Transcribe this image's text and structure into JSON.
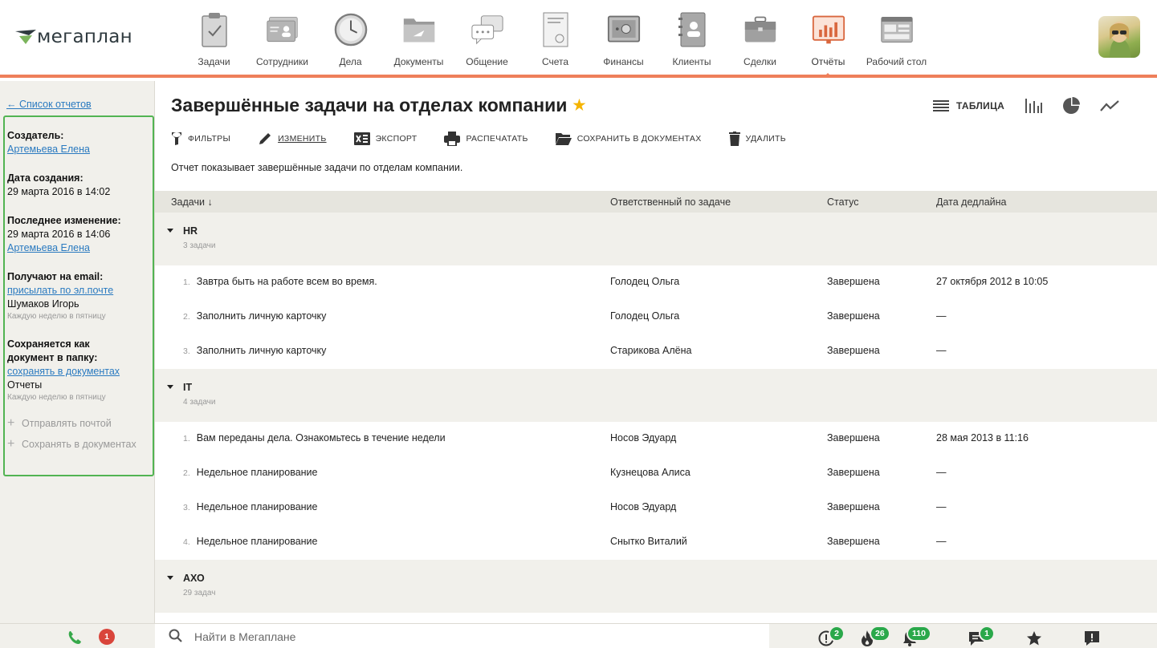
{
  "brand": {
    "name": "мегаплан"
  },
  "nav": [
    {
      "label": "Задачи",
      "icon": "clipboard-check-icon"
    },
    {
      "label": "Сотрудники",
      "icon": "id-card-icon"
    },
    {
      "label": "Дела",
      "icon": "clock-icon"
    },
    {
      "label": "Документы",
      "icon": "folder-icon"
    },
    {
      "label": "Общение",
      "icon": "chat-bubbles-icon"
    },
    {
      "label": "Счета",
      "icon": "invoice-icon"
    },
    {
      "label": "Финансы",
      "icon": "safe-icon"
    },
    {
      "label": "Клиенты",
      "icon": "contacts-book-icon"
    },
    {
      "label": "Сделки",
      "icon": "briefcase-icon"
    },
    {
      "label": "Отчёты",
      "icon": "report-board-icon",
      "active": true
    },
    {
      "label": "Рабочий стол",
      "icon": "dashboard-icon"
    }
  ],
  "sidebar": {
    "back_link": "← Список отчетов",
    "creator_label": "Создатель:",
    "creator_name": "Артемьева Елена",
    "created_label": "Дата создания:",
    "created_value": "29 марта 2016 в 14:02",
    "modified_label": "Последнее изменение:",
    "modified_value": "29 марта 2016 в 14:06",
    "modified_by": "Артемьева Елена",
    "email_label": "Получают на email:",
    "email_link": "присылать по эл.почте",
    "email_person": "Шумаков Игорь",
    "email_schedule": "Каждую неделю в пятницу",
    "save_label_1": "Сохраняется как",
    "save_label_2": "документ в папку:",
    "save_link": "сохранять в документах",
    "save_folder": "Отчеты",
    "save_schedule": "Каждую неделю в пятницу",
    "add_mail": "Отправлять почтой",
    "add_docs": "Сохранять в документах"
  },
  "report": {
    "title": "Завершённые задачи на отделах компании",
    "description": "Отчет показывает завершённые задачи по отделам компании."
  },
  "views": {
    "table_label": "ТАБЛИЦА"
  },
  "toolbar": {
    "filters": "ФИЛЬТРЫ",
    "edit": "ИЗМЕНИТЬ",
    "export": "ЭКСПОРТ",
    "print": "РАСПЕЧАТАТЬ",
    "save_docs": "СОХРАНИТЬ В ДОКУМЕНТАХ",
    "delete": "УДАЛИТЬ"
  },
  "columns": {
    "task": "Задачи ↓",
    "responsible": "Ответственный по задаче",
    "status": "Статус",
    "deadline": "Дата дедлайна"
  },
  "groups": [
    {
      "name": "HR",
      "count": "3 задачи",
      "rows": [
        {
          "n": "1.",
          "task": "Завтра быть на работе всем во время.",
          "responsible": "Голодец Ольга",
          "status": "Завершена",
          "deadline": "27 октября 2012 в 10:05"
        },
        {
          "n": "2.",
          "task": "Заполнить личную карточку",
          "responsible": "Голодец Ольга",
          "status": "Завершена",
          "deadline": "—"
        },
        {
          "n": "3.",
          "task": "Заполнить личную карточку",
          "responsible": "Старикова Алёна",
          "status": "Завершена",
          "deadline": "—"
        }
      ]
    },
    {
      "name": "IT",
      "count": "4 задачи",
      "rows": [
        {
          "n": "1.",
          "task": "Вам переданы дела. Ознакомьтесь в течение недели",
          "responsible": "Носов Эдуард",
          "status": "Завершена",
          "deadline": "28 мая 2013 в 11:16"
        },
        {
          "n": "2.",
          "task": "Недельное планирование",
          "responsible": "Кузнецова Алиса",
          "status": "Завершена",
          "deadline": "—"
        },
        {
          "n": "3.",
          "task": "Недельное планирование",
          "responsible": "Носов Эдуард",
          "status": "Завершена",
          "deadline": "—"
        },
        {
          "n": "4.",
          "task": "Недельное планирование",
          "responsible": "Снытко Виталий",
          "status": "Завершена",
          "deadline": "—"
        }
      ]
    },
    {
      "name": "АХО",
      "count": "29 задач",
      "rows": []
    }
  ],
  "bottombar": {
    "missed_calls": "1",
    "search_placeholder": "Найти в Мегаплане",
    "alerts": "2",
    "hot": "26",
    "notifications": "110",
    "messages": "1"
  },
  "colors": {
    "accent": "#ee7f5a",
    "link": "#2a7ac0",
    "highlight_border": "#52b452",
    "badge_green": "#2aa84a",
    "badge_red": "#d9453b",
    "star": "#f5b400"
  }
}
